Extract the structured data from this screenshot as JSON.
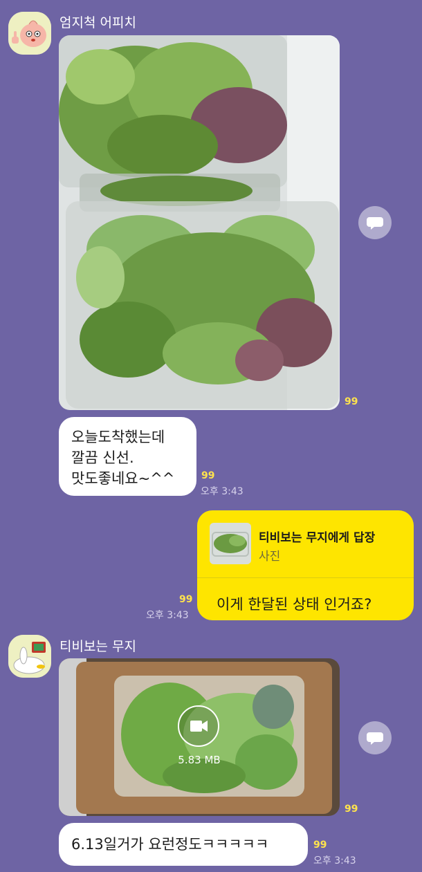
{
  "colors": {
    "background": "#6e64a4",
    "bubble_received": "#ffffff",
    "bubble_sent": "#fee500",
    "unread_count": "#ffe34d"
  },
  "messages": {
    "m1": {
      "sender": "엄지척 어피치",
      "photo_unread": "99",
      "text": "오늘도착했는데\n깔끔 신선.\n맛도좋네요~^^",
      "unread": "99",
      "time": "오후 3:43"
    },
    "m2": {
      "reply_title": "티비보는 무지에게 답장",
      "reply_type": "사진",
      "text": "이게 한달된 상태 인거죠?",
      "unread": "99",
      "time": "오후 3:43"
    },
    "m3": {
      "sender": "티비보는 무지",
      "video_size": "5.83 MB",
      "video_unread": "99",
      "text": "6.13일거가 요런정도ㅋㅋㅋㅋㅋ",
      "unread": "99",
      "time": "오후 3:43"
    }
  },
  "icons": {
    "share": "speech-bubble-share-icon",
    "play": "video-camera-icon"
  }
}
